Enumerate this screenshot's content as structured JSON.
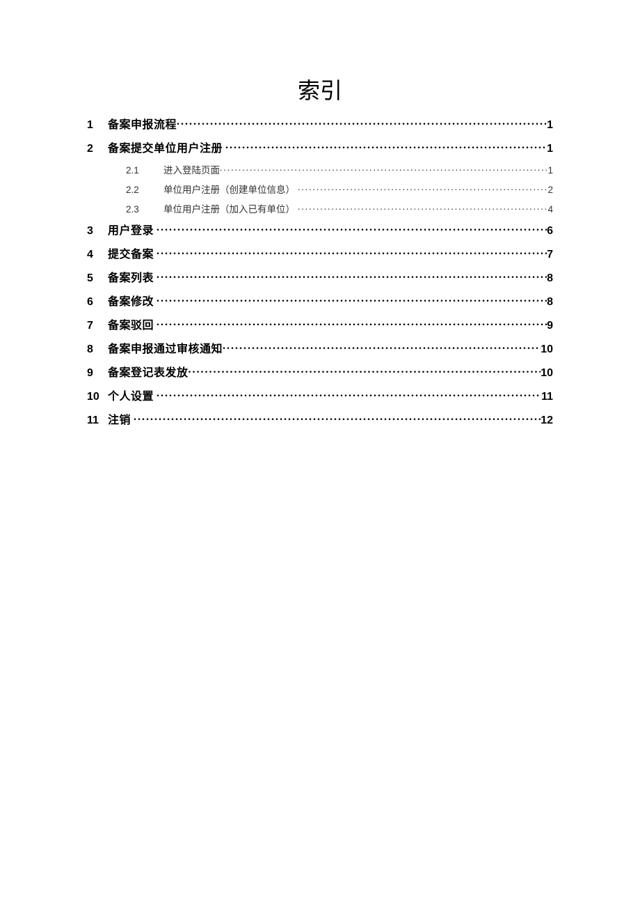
{
  "title": "索引",
  "toc": {
    "entries": [
      {
        "level": 1,
        "num": "1",
        "label": "备案申报流程",
        "page": "1"
      },
      {
        "level": 1,
        "num": "2",
        "label": "备案提交单位用户注册",
        "page": "1"
      },
      {
        "level": 2,
        "num": "2.1",
        "label": "进入登陆页面",
        "page": "1"
      },
      {
        "level": 2,
        "num": "2.2",
        "label": "单位用户注册（创建单位信息）",
        "page": "2"
      },
      {
        "level": 2,
        "num": "2.3",
        "label": "单位用户注册（加入已有单位）",
        "page": "4"
      },
      {
        "level": 1,
        "num": "3",
        "label": "用户登录",
        "page": "6"
      },
      {
        "level": 1,
        "num": "4",
        "label": "提交备案",
        "page": "7"
      },
      {
        "level": 1,
        "num": "5",
        "label": "备案列表",
        "page": "8"
      },
      {
        "level": 1,
        "num": "6",
        "label": "备案修改",
        "page": "8"
      },
      {
        "level": 1,
        "num": "7",
        "label": "备案驳回",
        "page": "9"
      },
      {
        "level": 1,
        "num": "8",
        "label": "备案申报通过审核通知",
        "page": "10"
      },
      {
        "level": 1,
        "num": "9",
        "label": "备案登记表发放",
        "page": "10"
      },
      {
        "level": 1,
        "num": "10",
        "label": "个人设置",
        "page": "11"
      },
      {
        "level": 1,
        "num": "11",
        "label": "注销",
        "page": "12"
      }
    ]
  }
}
